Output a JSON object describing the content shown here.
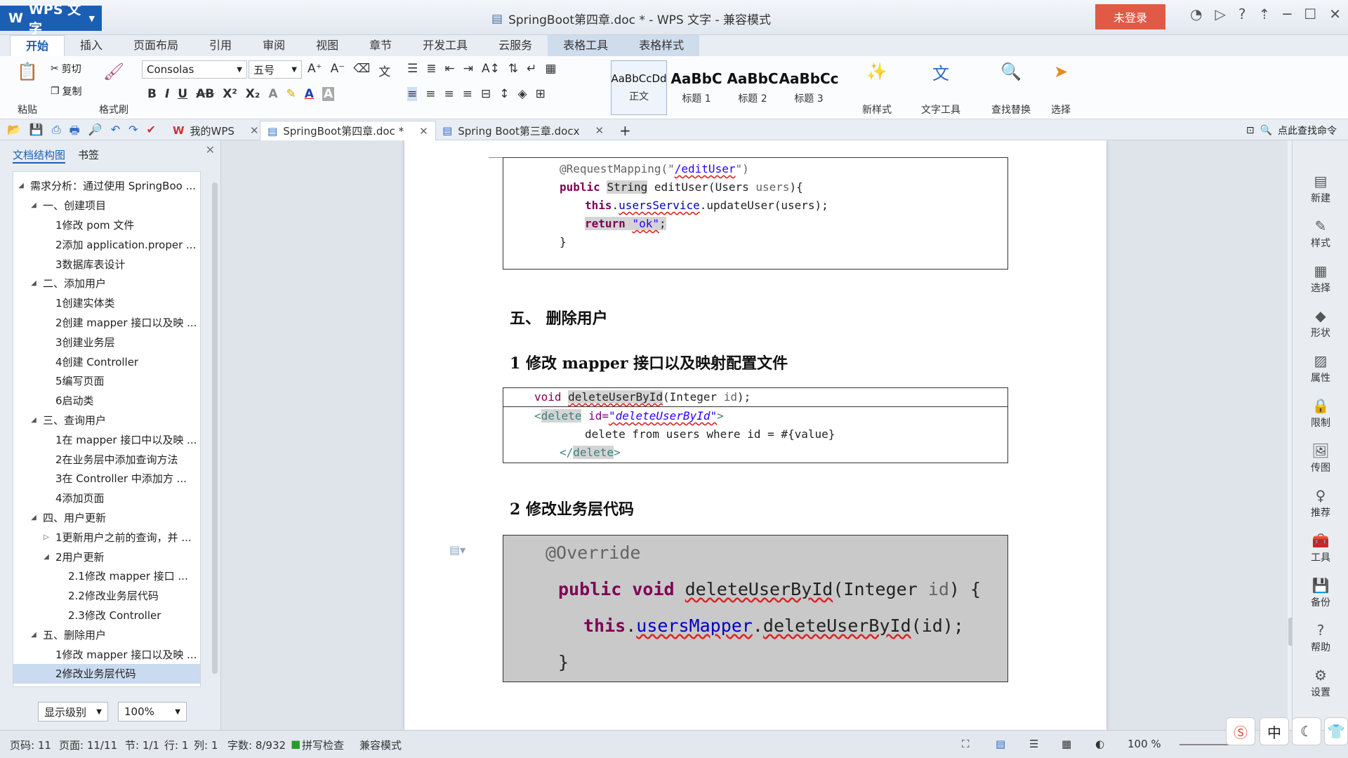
{
  "titlebar": {
    "app_name": "WPS 文字",
    "doc_title": "SpringBoot第四章.doc * - WPS 文字 - 兼容模式",
    "login": "未登录"
  },
  "ribbon_tabs": [
    "开始",
    "插入",
    "页面布局",
    "引用",
    "审阅",
    "视图",
    "章节",
    "开发工具",
    "云服务",
    "表格工具",
    "表格样式"
  ],
  "ribbon": {
    "paste": "粘贴",
    "cut": "剪切",
    "copy": "复制",
    "format_painter": "格式刷",
    "font_name": "Consolas",
    "font_size": "五号",
    "styles": [
      {
        "sample": "AaBbCcDd",
        "name": "正文"
      },
      {
        "sample": "AaBbC",
        "name": "标题 1"
      },
      {
        "sample": "AaBbC",
        "name": "标题 2"
      },
      {
        "sample": "AaBbCc",
        "name": "标题 3"
      }
    ],
    "new_style": "新样式",
    "text_tools": "文字工具",
    "find_replace": "查找替换",
    "select": "选择"
  },
  "doctabs": {
    "my_wps": "我的WPS",
    "tab1": "SpringBoot第四章.doc *",
    "tab2": "Spring Boot第三章.docx",
    "command_search": "点此查找命令"
  },
  "navpane": {
    "tab_outline": "文档结构图",
    "tab_bookmark": "书签",
    "nodes": [
      {
        "label": "需求分析：通过使用 SpringBoo ...",
        "level": 0,
        "toggle": "◢"
      },
      {
        "label": "一、创建项目",
        "level": 1,
        "toggle": "◢"
      },
      {
        "label": "1修改 pom 文件",
        "level": 2,
        "toggle": ""
      },
      {
        "label": "2添加 application.proper ...",
        "level": 2,
        "toggle": ""
      },
      {
        "label": "3数据库表设计",
        "level": 2,
        "toggle": ""
      },
      {
        "label": "二、添加用户",
        "level": 1,
        "toggle": "◢"
      },
      {
        "label": "1创建实体类",
        "level": 2,
        "toggle": ""
      },
      {
        "label": "2创建 mapper 接口以及映 ...",
        "level": 2,
        "toggle": ""
      },
      {
        "label": "3创建业务层",
        "level": 2,
        "toggle": ""
      },
      {
        "label": "4创建 Controller",
        "level": 2,
        "toggle": ""
      },
      {
        "label": "5编写页面",
        "level": 2,
        "toggle": ""
      },
      {
        "label": "6启动类",
        "level": 2,
        "toggle": ""
      },
      {
        "label": "三、查询用户",
        "level": 1,
        "toggle": "◢"
      },
      {
        "label": "1在 mapper 接口中以及映 ...",
        "level": 2,
        "toggle": ""
      },
      {
        "label": "2在业务层中添加查询方法",
        "level": 2,
        "toggle": ""
      },
      {
        "label": "3在 Controller 中添加方 ...",
        "level": 2,
        "toggle": ""
      },
      {
        "label": "4添加页面",
        "level": 2,
        "toggle": ""
      },
      {
        "label": "四、用户更新",
        "level": 1,
        "toggle": "◢"
      },
      {
        "label": "1更新用户之前的查询，并 ...",
        "level": 2,
        "toggle": "▷"
      },
      {
        "label": "2用户更新",
        "level": 2,
        "toggle": "◢"
      },
      {
        "label": "2.1修改 mapper 接口 ...",
        "level": 3,
        "toggle": ""
      },
      {
        "label": "2.2修改业务层代码",
        "level": 3,
        "toggle": ""
      },
      {
        "label": "2.3修改 Controller",
        "level": 3,
        "toggle": ""
      },
      {
        "label": "五、删除用户",
        "level": 1,
        "toggle": "◢"
      },
      {
        "label": "1修改 mapper 接口以及映 ...",
        "level": 2,
        "toggle": ""
      },
      {
        "label": "2修改业务层代码",
        "level": 2,
        "toggle": "",
        "selected": true
      }
    ],
    "display_level": "显示级别",
    "zoom": "100%"
  },
  "document": {
    "code1": {
      "l1a": "@RequestMapping(\"",
      "l1b": "/editUser",
      "l1c": "\")",
      "l2a": "public ",
      "l2b": "String",
      "l2c": " editUser(Users ",
      "l2d": "users",
      "l2e": "){",
      "l3a": "this",
      "l3b": ".",
      "l3c": "usersService",
      "l3d": ".updateUser(users);",
      "l4a": "return ",
      "l4b": "\"ok\"",
      "l4c": ";",
      "l5": "}"
    },
    "h_section5": "五、    删除用户",
    "h_sub1": "1    修改 mapper 接口以及映射配置文件",
    "code2": {
      "l1a": "void ",
      "l1b": "deleteUserById",
      "l1c": "(Integer ",
      "l1d": "id",
      "l1e": ");",
      "l2a": "<",
      "l2b": "delete",
      "l2c": " id=",
      "l2d": "\"deleteUserById\"",
      "l2e": ">",
      "l3": "delete from users where id = #{value}",
      "l4a": "</",
      "l4b": "delete",
      "l4c": ">"
    },
    "h_sub2": "2    修改业务层代码",
    "code3": {
      "l1": "@Override",
      "l2a": "public void ",
      "l2b": "deleteUserById",
      "l2c": "(Integer ",
      "l2d": "id",
      "l2e": ") {",
      "l3a": "this",
      "l3b": ".",
      "l3c": "usersMapper",
      "l3d": ".",
      "l3e": "deleteUserById",
      "l3f": "(id);",
      "l4": "}"
    }
  },
  "right_sidebar": [
    "新建",
    "样式",
    "选择",
    "形状",
    "属性",
    "限制",
    "传图",
    "推荐",
    "工具",
    "备份",
    "帮助",
    "设置"
  ],
  "statusbar": {
    "page": "页码: 11",
    "pages": "页面: 11/11",
    "section": "节: 1/1",
    "line": "行: 1",
    "col": "列: 1",
    "words": "字数: 8/932",
    "spell": "拼写检查",
    "compat": "兼容模式",
    "zoom": "100 %"
  },
  "tray": [
    "中"
  ]
}
